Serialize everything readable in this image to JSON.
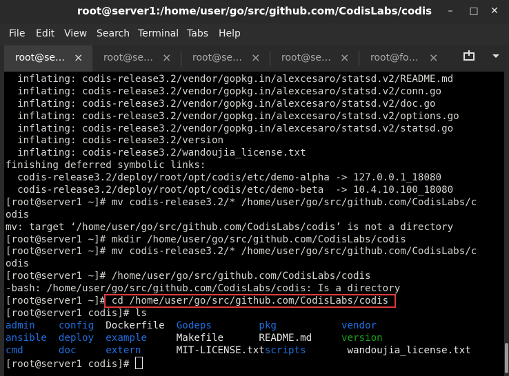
{
  "window": {
    "title": "root@server1:/home/user/go/src/github.com/CodisLabs/codis",
    "minimize_icon": "minimize-icon",
    "maximize_icon": "maximize-icon",
    "close_icon": "close-icon"
  },
  "menu": {
    "items": [
      "File",
      "Edit",
      "View",
      "Search",
      "Terminal",
      "Tabs",
      "Help"
    ]
  },
  "tabs": [
    {
      "label": "root@se…",
      "active": true
    },
    {
      "label": "root@se…",
      "active": false
    },
    {
      "label": "root@se…",
      "active": false
    },
    {
      "label": "root@se…",
      "active": false
    },
    {
      "label": "root@fo…",
      "active": false
    }
  ],
  "tab_close_glyph": "×",
  "toolbar": {
    "new_tab_icon": "new-tab-icon",
    "menu_icon": "chevron-down-icon"
  },
  "colors": {
    "directory": "#1f6fe0",
    "executable": "#18a118",
    "highlight_box": "#e03b3b",
    "terminal_bg": "#000000",
    "terminal_fg": "#d3d7cf"
  },
  "terminal": {
    "lines": [
      "  inflating: codis-release3.2/vendor/gopkg.in/alexcesaro/statsd.v2/README.md",
      "  inflating: codis-release3.2/vendor/gopkg.in/alexcesaro/statsd.v2/conn.go",
      "  inflating: codis-release3.2/vendor/gopkg.in/alexcesaro/statsd.v2/doc.go",
      "  inflating: codis-release3.2/vendor/gopkg.in/alexcesaro/statsd.v2/options.go",
      "  inflating: codis-release3.2/vendor/gopkg.in/alexcesaro/statsd.v2/statsd.go",
      "  inflating: codis-release3.2/version",
      "  inflating: codis-release3.2/wandoujia_license.txt",
      "finishing deferred symbolic links:",
      "  codis-release3.2/deploy/root/opt/codis/etc/demo-alpha -> 127.0.0.1_18080",
      "  codis-release3.2/deploy/root/opt/codis/etc/demo-beta  -> 10.4.10.100_18080",
      "[root@server1 ~]# mv codis-release3.2/* /home/user/go/src/github.com/CodisLabs/c",
      "odis",
      "mv: target ‘/home/user/go/src/github.com/CodisLabs/codis’ is not a directory",
      "[root@server1 ~]# mkdir /home/user/go/src/github.com/CodisLabs/codis",
      "[root@server1 ~]# mv codis-release3.2/* /home/user/go/src/github.com/CodisLabs/c",
      "odis",
      "[root@server1 ~]# /home/user/go/src/github.com/CodisLabs/codis",
      "-bash: /home/user/go/src/github.com/CodisLabs/codis: Is a directory"
    ],
    "highlighted_prompt": "[root@server1 ~]#",
    "highlighted_command": " cd /home/user/go/src/github.com/CodisLabs/codis ",
    "ls_prompt": "[root@server1 codis]# ls",
    "ls_rows": [
      [
        {
          "text": "admin",
          "kind": "dir"
        },
        {
          "text": "config",
          "kind": "dir"
        },
        {
          "text": "Dockerfile",
          "kind": "file"
        },
        {
          "text": "Godeps",
          "kind": "dir"
        },
        {
          "text": "pkg",
          "kind": "dir"
        },
        {
          "text": "vendor",
          "kind": "dir"
        }
      ],
      [
        {
          "text": "ansible",
          "kind": "dir"
        },
        {
          "text": "deploy",
          "kind": "dir"
        },
        {
          "text": "example",
          "kind": "dir"
        },
        {
          "text": "Makefile",
          "kind": "file"
        },
        {
          "text": "README.md",
          "kind": "file"
        },
        {
          "text": "version",
          "kind": "exec"
        }
      ],
      [
        {
          "text": "cmd",
          "kind": "dir"
        },
        {
          "text": "doc",
          "kind": "dir"
        },
        {
          "text": "extern",
          "kind": "dir"
        },
        {
          "text": "MIT-LICENSE.txt",
          "kind": "file"
        },
        {
          "text": "scripts",
          "kind": "dir"
        },
        {
          "text": "wandoujia_license.txt",
          "kind": "file"
        }
      ]
    ],
    "final_prompt": "[root@server1 codis]# "
  }
}
